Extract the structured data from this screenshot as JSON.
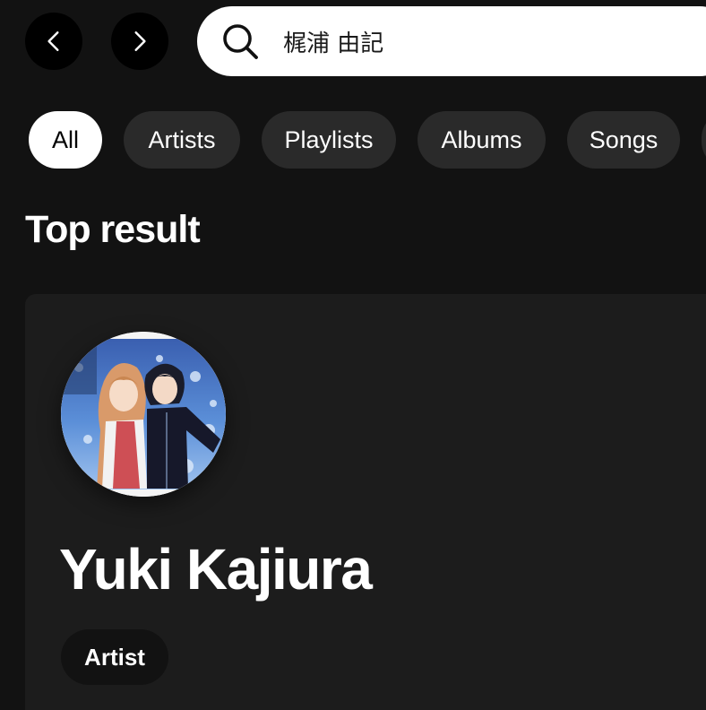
{
  "nav": {
    "back_icon": "chevron-left-icon",
    "forward_icon": "chevron-right-icon"
  },
  "search": {
    "icon": "search-icon",
    "value": "梶浦 由記"
  },
  "filters": {
    "active": "All",
    "chips": [
      "All",
      "Artists",
      "Playlists",
      "Albums",
      "Songs"
    ]
  },
  "top_result": {
    "section_title": "Top result",
    "artist_name": "Yuki Kajiura",
    "type_label": "Artist"
  },
  "colors": {
    "background": "#121212",
    "card": "#1c1c1c",
    "chip": "#2a2a2a",
    "chip_active": "#ffffff"
  }
}
